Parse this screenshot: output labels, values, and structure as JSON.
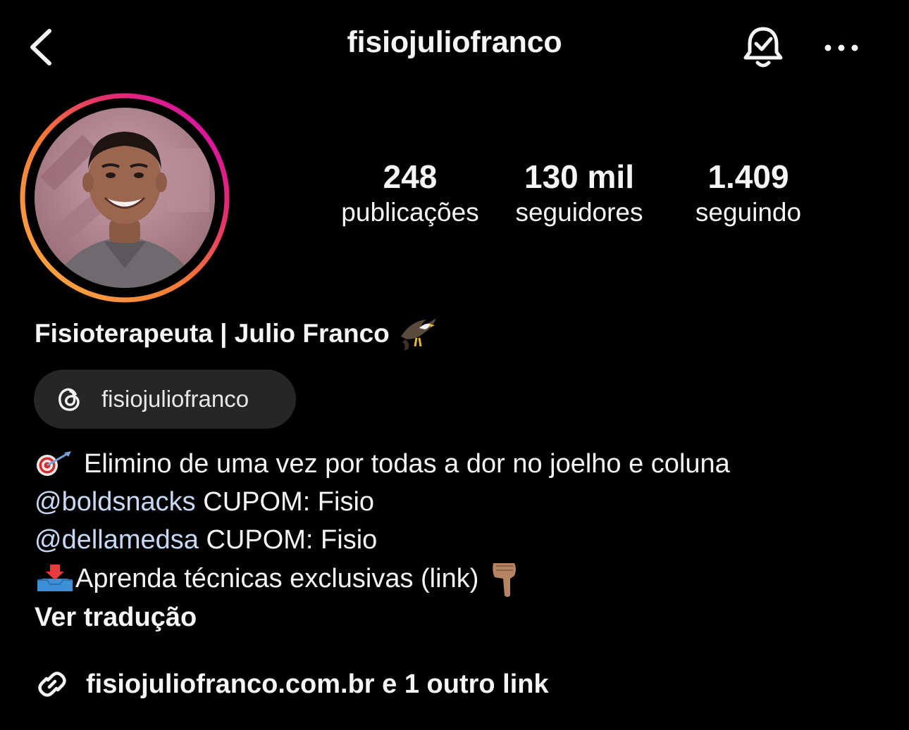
{
  "header": {
    "username": "fisiojuliofranco"
  },
  "stats": [
    {
      "value": "248",
      "label": "publicações"
    },
    {
      "value": "130 mil",
      "label": "seguidores"
    },
    {
      "value": "1.409",
      "label": "seguindo"
    }
  ],
  "profile": {
    "full_name": "Fisioterapeuta | Julio Franco",
    "name_emoji": "eagle-emoji",
    "threads_handle": "fisiojuliofranco"
  },
  "bio": {
    "line1_text": "Elimino de uma vez por todas a dor no joelho e coluna",
    "line1_emoji": "target-emoji",
    "line2_mention": "@boldsnacks",
    "line2_text": " CUPOM: Fisio",
    "line3_mention": "@dellamedsa",
    "line3_text": " CUPOM: Fisio",
    "line4_text": "Aprenda técnicas exclusivas (link) ",
    "line4_emojis": [
      "inbox-tray-emoji",
      "pointing-down-emoji"
    ],
    "translate_label": "Ver tradução"
  },
  "link": {
    "text": "fisiojuliofranco.com.br e 1 outro link"
  },
  "colors": {
    "background": "#000000",
    "text": "#f5f5f5",
    "mention": "#c8d8f5",
    "pill": "#262626",
    "story_ring_start": "#fcaf45",
    "story_ring_mid": "#e1306c",
    "story_ring_end": "#d300c5"
  }
}
